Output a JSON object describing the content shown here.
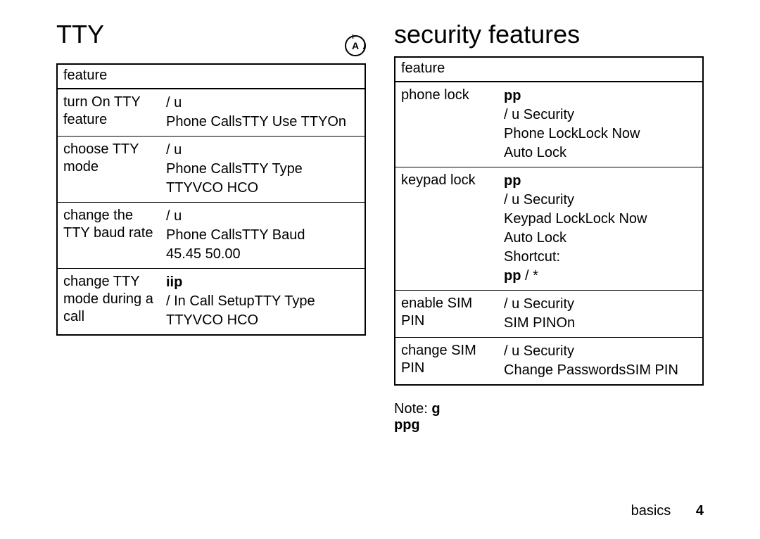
{
  "left": {
    "heading": "TTY",
    "table_header": "feature",
    "rows": [
      {
        "label": "turn On TTY feature",
        "desc": " / u\nPhone CallsTTY Use TTYOn"
      },
      {
        "label": "choose TTY mode",
        "desc": " / u\nPhone CallsTTY Type\n TTYVCO HCO"
      },
      {
        "label": "change the TTY baud rate",
        "desc": " / u\nPhone CallsTTY Baud\n 45.45 50.00"
      },
      {
        "label": "change TTY mode during a call",
        "desc_prefix": "iip",
        "desc_rest": "/ In Call SetupTTY Type\n TTYVCO HCO"
      }
    ]
  },
  "right": {
    "heading": "security features",
    "table_header": "feature",
    "rows": [
      {
        "label": "phone lock",
        "desc_prefix": "pp",
        "desc_rest": " / u Security\nPhone LockLock Now\nAuto Lock"
      },
      {
        "label": "keypad lock",
        "desc_prefix": "pp",
        "desc_rest": " / u Security\nKeypad LockLock Now\nAuto Lock\nShortcut:",
        "desc_prefix2": "pp",
        "desc_rest2": " / *"
      },
      {
        "label": "enable SIM PIN",
        "desc": " / u Security\nSIM PINOn"
      },
      {
        "label": "change SIM PIN",
        "desc": " / u Security\nChange PasswordsSIM PIN"
      }
    ],
    "note_label": "Note: ",
    "note_g": "g",
    "note_ppg": "ppg"
  },
  "footer": {
    "section": "basics",
    "page": "4"
  }
}
